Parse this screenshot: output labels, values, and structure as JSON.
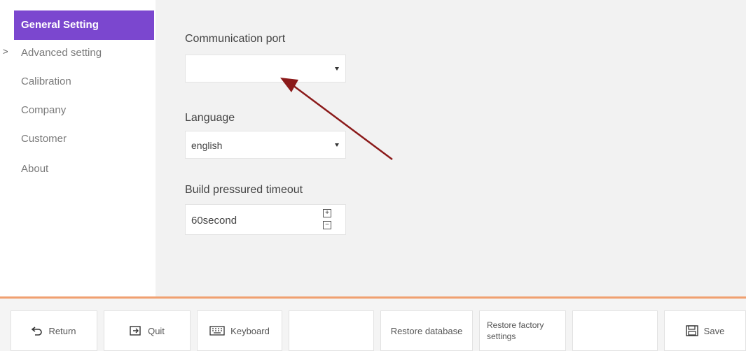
{
  "sidebar": {
    "items": [
      {
        "label": "General Setting",
        "active": true
      },
      {
        "label": "Advanced setting",
        "expandable": true
      },
      {
        "label": "Calibration"
      },
      {
        "label": "Company"
      },
      {
        "label": "Customer"
      },
      {
        "label": "About"
      }
    ],
    "chevron": ">"
  },
  "form": {
    "comm_port": {
      "label": "Communication port",
      "value": ""
    },
    "language": {
      "label": "Language",
      "value": "english"
    },
    "timeout": {
      "label": "Build pressured timeout",
      "value": "60second"
    }
  },
  "toolbar": {
    "return_label": "Return",
    "quit_label": "Quit",
    "keyboard_label": "Keyboard",
    "restore_db_label": "Restore database",
    "restore_factory_label": "Restore factory settings",
    "save_label": "Save"
  },
  "colors": {
    "accent": "#7b47cf",
    "toolbar_line": "#f0a070",
    "arrow": "#8b1a1a"
  },
  "icons": {
    "return": "return-arrow-icon",
    "quit": "exit-icon",
    "keyboard": "keyboard-icon",
    "save": "floppy-disk-icon",
    "dropdown": "caret-down-icon",
    "plus": "plus-icon",
    "minus": "minus-icon"
  }
}
